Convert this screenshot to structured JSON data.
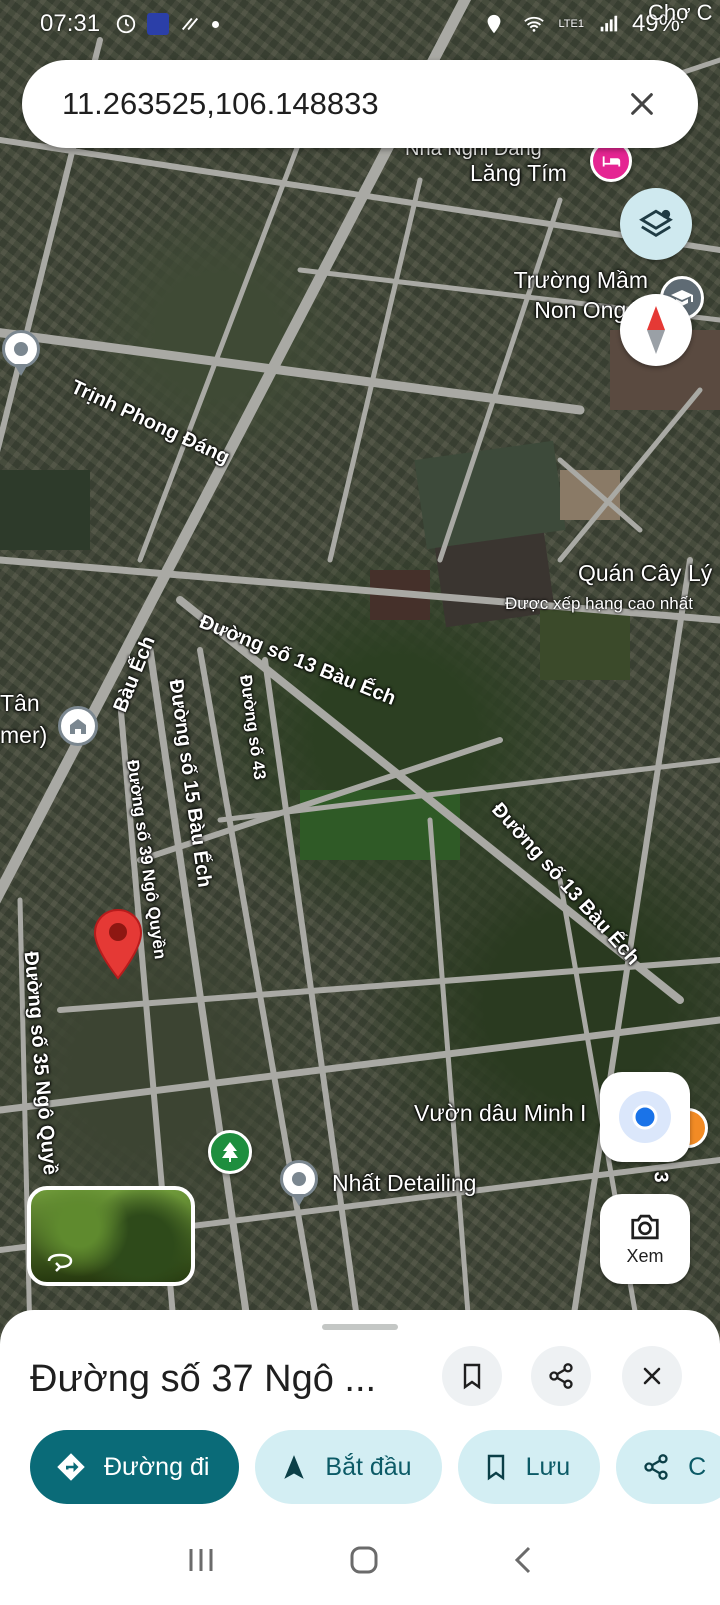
{
  "status_bar": {
    "time": "07:31",
    "battery": "49%",
    "network": "LTE1",
    "corner_label": "Chợ C"
  },
  "search": {
    "query": "11.263525,106.148833",
    "close_icon": "close-icon"
  },
  "map": {
    "road_labels": [
      "Trịnh Phong Đáng",
      "Đường số 13 Bàu Ếch",
      "Bàu Ếch",
      "Đường số 15 Bàu Ếch",
      "Đường số 43",
      "Đường số 39 Ngô Quyền",
      "Đường số 13 Bàu Ếch",
      "Đường số 35 Ngô Quyề",
      "Nha Nghi Dang",
      "Lăng Tím",
      "3"
    ],
    "places": {
      "school": "Trường Mầm Non Ong V",
      "cafe": "Quán Cây Lý",
      "cafe_sub": "Được xếp hạng cao nhất",
      "garden": "Vườn dâu Minh I",
      "detailing": "Nhất Detailing",
      "tan_fragment": "Tân",
      "mer_fragment": "mer)"
    }
  },
  "controls": {
    "layers_icon": "layers-icon",
    "compass_icon": "compass-icon",
    "my_location_icon": "my-location-icon",
    "lens_label": "Xem"
  },
  "sheet": {
    "title": "Đường số 37 Ngô ...",
    "actions": {
      "directions": "Đường đi",
      "start": "Bắt đầu",
      "save": "Lưu",
      "share": "C"
    }
  },
  "colors": {
    "pin_red": "#e53935",
    "primary_teal": "#0a6b78",
    "chip_bg": "#d3eef3"
  }
}
